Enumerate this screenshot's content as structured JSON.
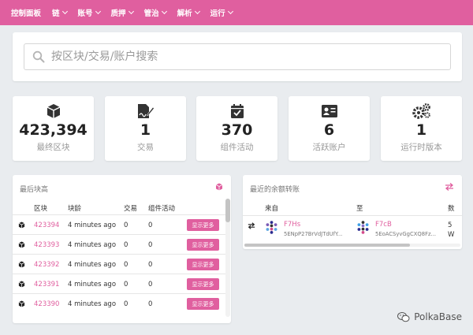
{
  "nav": [
    {
      "label": "控制面板",
      "dropdown": false
    },
    {
      "label": "链",
      "dropdown": true
    },
    {
      "label": "账号",
      "dropdown": true
    },
    {
      "label": "质押",
      "dropdown": true
    },
    {
      "label": "管治",
      "dropdown": true
    },
    {
      "label": "解析",
      "dropdown": true
    },
    {
      "label": "运行",
      "dropdown": true
    }
  ],
  "search": {
    "placeholder": "按区块/交易/账户搜索"
  },
  "stats": [
    {
      "icon": "cube-icon",
      "value": "423,394",
      "label": "最终区块"
    },
    {
      "icon": "signed-doc-icon",
      "value": "1",
      "label": "交易"
    },
    {
      "icon": "calendar-check-icon",
      "value": "370",
      "label": "组件活动"
    },
    {
      "icon": "id-card-icon",
      "value": "6",
      "label": "活跃账户"
    },
    {
      "icon": "gears-icon",
      "value": "1",
      "label": "运行时版本"
    }
  ],
  "latest_blocks": {
    "title": "最后块高",
    "columns": [
      "区块",
      "块龄",
      "交易",
      "组件活动"
    ],
    "button_label": "显示更多",
    "rows": [
      {
        "block": "423394",
        "age": "4 minutes ago",
        "tx": "0",
        "events": "0"
      },
      {
        "block": "423393",
        "age": "4 minutes ago",
        "tx": "0",
        "events": "0"
      },
      {
        "block": "423392",
        "age": "4 minutes ago",
        "tx": "0",
        "events": "0"
      },
      {
        "block": "423391",
        "age": "4 minutes ago",
        "tx": "0",
        "events": "0"
      },
      {
        "block": "423390",
        "age": "4 minutes ago",
        "tx": "0",
        "events": "0"
      }
    ]
  },
  "transfers": {
    "title": "最近的余额转账",
    "columns": [
      "来自",
      "至",
      "数"
    ],
    "rows": [
      {
        "from_name": "F7Hs",
        "from_hash": "5ENpP27BrVdJTdUfY...",
        "to_name": "F7cB",
        "to_hash": "5EoACSyvGgCXQ8Fz...",
        "amount_top": "5",
        "amount_bottom": "W"
      }
    ]
  },
  "watermark": "PolkaBase",
  "colors": {
    "accent": "#e05f9f",
    "background": "#e9ecef"
  }
}
